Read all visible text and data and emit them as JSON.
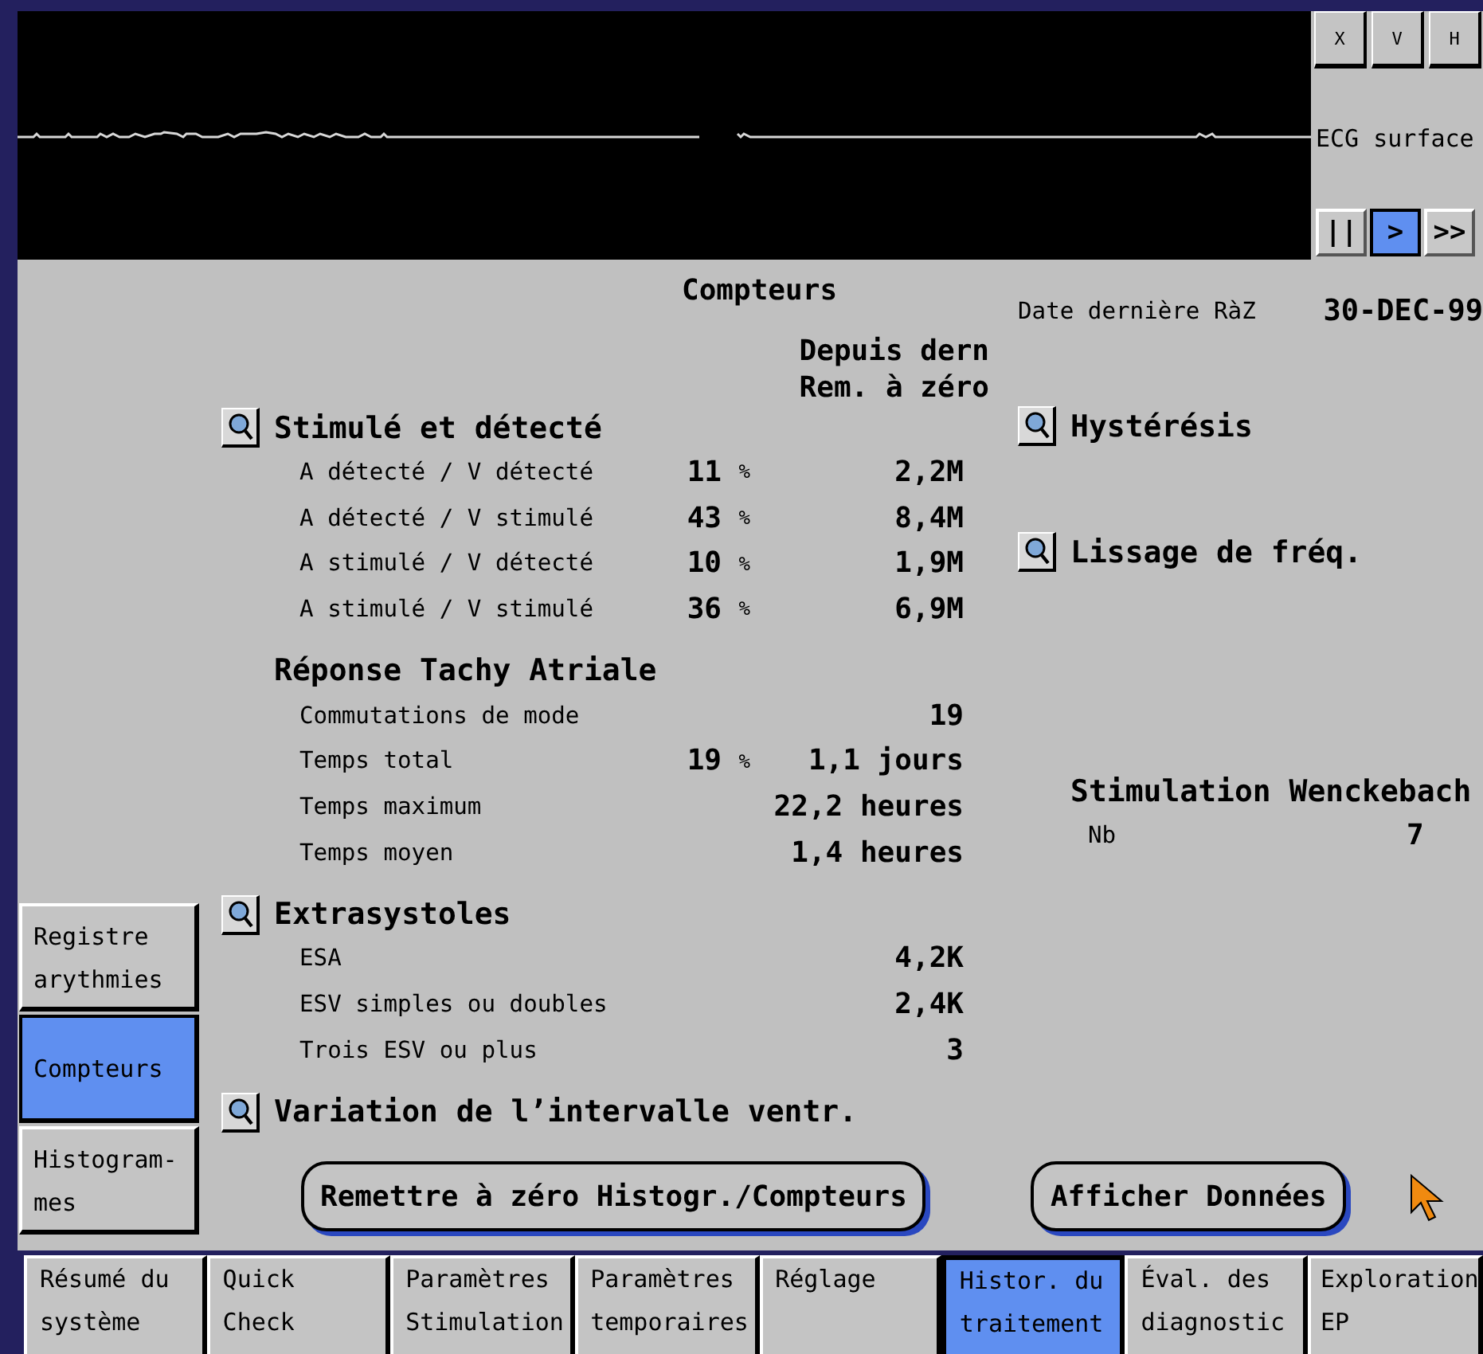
{
  "ecg": {
    "channel_label": "ECG surface",
    "view_buttons": [
      "X",
      "V",
      "H"
    ],
    "playback_buttons": [
      {
        "label": "||",
        "selected": false
      },
      {
        "label": ">",
        "selected": true
      },
      {
        "label": ">>",
        "selected": false
      }
    ]
  },
  "side_tabs": [
    {
      "label": "Registre arythmies",
      "selected": false
    },
    {
      "label": "Compteurs",
      "selected": true
    },
    {
      "label": "Histogram-mes",
      "selected": false
    }
  ],
  "counters": {
    "title": "Compteurs",
    "column_header": [
      "Depuis dern",
      "Rem. à zéro"
    ],
    "sections": [
      {
        "title": "Stimulé et détecté",
        "zoom_button": true,
        "rows": [
          {
            "label": "A détecté / V détecté",
            "percent": "11",
            "unit": "%",
            "value": "2,2M"
          },
          {
            "label": "A détecté / V stimulé",
            "percent": "43",
            "unit": "%",
            "value": "8,4M"
          },
          {
            "label": "A stimulé / V détecté",
            "percent": "10",
            "unit": "%",
            "value": "1,9M"
          },
          {
            "label": "A stimulé / V stimulé",
            "percent": "36",
            "unit": "%",
            "value": "6,9M"
          }
        ]
      },
      {
        "title": "Réponse Tachy Atriale",
        "zoom_button": false,
        "rows": [
          {
            "label": "Commutations de mode",
            "value": "19"
          },
          {
            "label": "Temps total",
            "percent": "19",
            "unit": "%",
            "value": "1,1 jours"
          },
          {
            "label": "Temps maximum",
            "value": "22,2 heures"
          },
          {
            "label": "Temps moyen",
            "value": "1,4 heures"
          }
        ]
      },
      {
        "title": "Extrasystoles",
        "zoom_button": true,
        "rows": [
          {
            "label": "ESA",
            "value": "4,2K"
          },
          {
            "label": "ESV simples ou doubles",
            "value": "2,4K"
          },
          {
            "label": "Trois ESV ou plus",
            "value": "3"
          }
        ]
      },
      {
        "title": "Variation de l’intervalle ventr.",
        "zoom_button": true
      }
    ]
  },
  "reset_info": {
    "label": "Date dernière RàZ",
    "value": "30-DEC-99"
  },
  "detail_links": [
    {
      "title": "Hystérésis"
    },
    {
      "title": "Lissage de fréq."
    }
  ],
  "wenckebach": {
    "title": "Stimulation Wenckebach",
    "rows": [
      {
        "label": "Nb",
        "value": "7"
      }
    ]
  },
  "buttons": [
    "Remettre à zéro Histogr./Compteurs",
    "Afficher Données"
  ],
  "bottom_tabs": [
    {
      "label": "Résumé du système",
      "selected": false
    },
    {
      "label": "Quick Check",
      "selected": false
    },
    {
      "label": "Paramètres Stimulation",
      "selected": false
    },
    {
      "label": "Paramètres temporaires",
      "selected": false
    },
    {
      "label": "Réglage",
      "selected": false
    },
    {
      "label": "Histor. du traitement",
      "selected": true
    },
    {
      "label": "Éval. des diagnostic",
      "selected": false
    },
    {
      "label": "Exploration EP",
      "selected": false
    }
  ]
}
